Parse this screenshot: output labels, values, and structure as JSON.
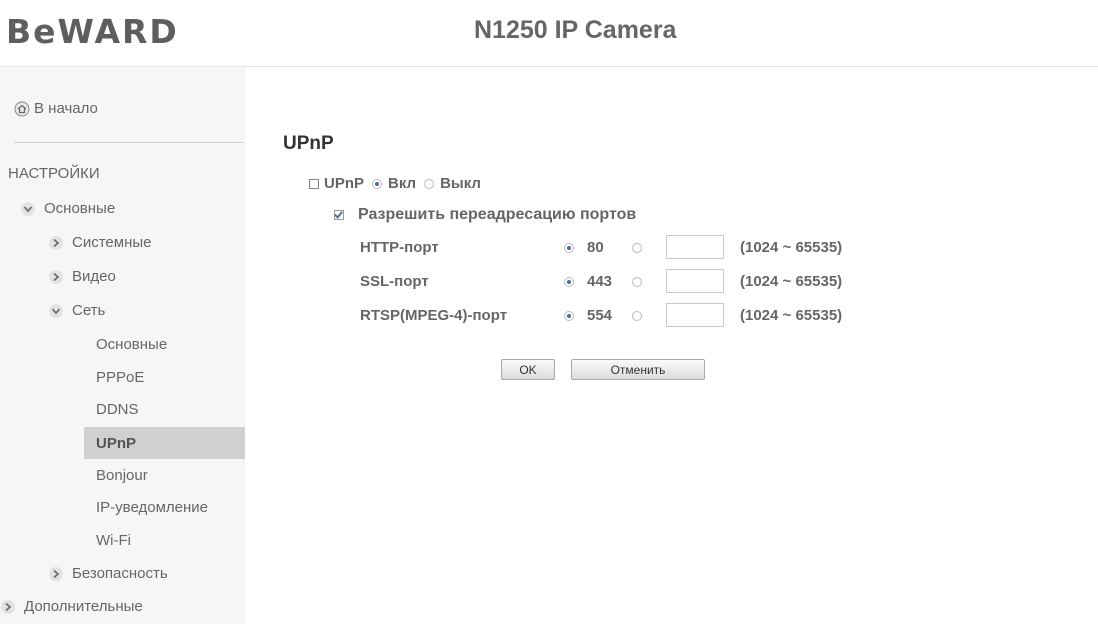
{
  "header": {
    "logo": "BeWARD",
    "camera_title": "N1250 IP Camera"
  },
  "sidebar": {
    "home": "В начало",
    "section_title": "НАСТРОЙКИ",
    "items": {
      "basic": "Основные",
      "system": "Системные",
      "video": "Видео",
      "network": "Сеть",
      "net_basic": "Основные",
      "pppoe": "PPPoE",
      "ddns": "DDNS",
      "upnp": "UPnP",
      "bonjour": "Bonjour",
      "ip_notify": "IP-уведомление",
      "wifi": "Wi-Fi",
      "security": "Безопасность",
      "advanced": "Дополнительные"
    }
  },
  "main": {
    "title": "UPnP",
    "upnp_label": "UPnP",
    "on_label": "Вкл",
    "off_label": "Выкл",
    "upnp_state": "on",
    "port_forward_label": "Разрешить переадресацию портов",
    "port_forward_checked": true,
    "ports": [
      {
        "label": "HTTP-порт",
        "default": "80",
        "custom_value": "",
        "range": "(1024 ~ 65535)"
      },
      {
        "label": "SSL-порт",
        "default": "443",
        "custom_value": "",
        "range": "(1024 ~ 65535)"
      },
      {
        "label": "RTSP(MPEG-4)-порт",
        "default": "554",
        "custom_value": "",
        "range": "(1024 ~ 65535)"
      }
    ],
    "ok_label": "OK",
    "cancel_label": "Отменить"
  },
  "colors": {
    "radio_selected": "#3f6fb0",
    "sidebar_bg": "#f6f6f6",
    "active_bg": "#d0d0d0"
  }
}
